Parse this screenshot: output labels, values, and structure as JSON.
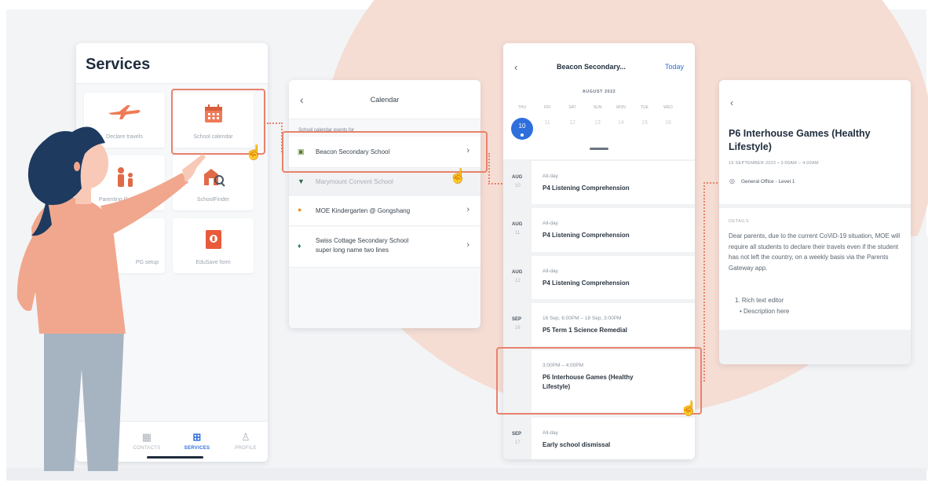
{
  "colors": {
    "accent_highlight": "#e8826c",
    "primary_blue": "#2f6fdc",
    "blob": "#f5ddd4",
    "background": "#f3f4f6"
  },
  "services": {
    "title": "Services",
    "tiles": [
      {
        "label": "Declare travels",
        "icon": "airplane-icon"
      },
      {
        "label": "School calendar",
        "icon": "calendar-icon"
      },
      {
        "label": "Parenting Resources",
        "icon": "parent-child-icon"
      },
      {
        "label": "SchoolFinder",
        "icon": "school-search-icon"
      },
      {
        "label": "PG setup",
        "icon": "setup-icon"
      },
      {
        "label": "EduSave form",
        "icon": "edusave-icon"
      }
    ],
    "tabs": [
      {
        "label": "CONTACTS",
        "icon": "contacts-icon"
      },
      {
        "label": "SERVICES",
        "icon": "services-icon"
      },
      {
        "label": "PROFILE",
        "icon": "profile-icon"
      }
    ]
  },
  "calendar_list": {
    "title": "Calendar",
    "subtitle": "School calendar events for",
    "schools": [
      {
        "name": "Beacon Secondary School",
        "line2": "",
        "icon": "school-crest-icon"
      },
      {
        "name": "Marymount Convent School",
        "line2": "",
        "icon": "school-crest-icon"
      },
      {
        "name": "MOE Kindergarten @ Gongshang",
        "line2": "",
        "icon": "school-crest-icon"
      },
      {
        "name": "Swiss Cottage Secondary School",
        "line2": "super long name two lines",
        "icon": "school-crest-icon"
      }
    ]
  },
  "calendar_events": {
    "header": "Beacon Secondary...",
    "today_label": "Today",
    "month": "AUGUST 2022",
    "weekdays": [
      "THU",
      "FRI",
      "SAT",
      "SUN",
      "MON",
      "TUE",
      "WED"
    ],
    "days": [
      "10",
      "11",
      "12",
      "13",
      "14",
      "15",
      "16"
    ],
    "selected_day": "10",
    "events": [
      {
        "month": "AUG",
        "day": "10",
        "time": "All-day",
        "name": "P4 Listening Comprehension"
      },
      {
        "month": "AUG",
        "day": "11",
        "time": "All-day",
        "name": "P4 Listening Comprehension"
      },
      {
        "month": "AUG",
        "day": "12",
        "time": "All-day",
        "name": "P4 Listening Comprehension"
      },
      {
        "month": "SEP",
        "day": "16",
        "time": "16 Sep, 6:00PM – 18 Sep, 3:00PM",
        "name": "P5 Term 1 Science Remedial"
      },
      {
        "month": "",
        "day": "",
        "time": "3:00PM – 4:00PM",
        "name": "P6 Interhouse Games (Healthy Lifestyle)"
      },
      {
        "month": "SEP",
        "day": "17",
        "time": "All-day",
        "name": "Early school dismissal"
      }
    ]
  },
  "event_detail": {
    "title": "P6 Interhouse Games (Healthy Lifestyle)",
    "datetime": "16 SEPTEMBER 2022 • 3:00AM – 4:00AM",
    "location": "General Office - Level 1",
    "details_label": "DETAILS",
    "description": "Dear parents, due to the current CoViD-19 situation, MOE will require all students to declare their travels even if the student has not left the country, on a weekly basis via the Parents Gateway app.",
    "list_item_1": "1. Rich text editor",
    "list_item_2": "• Description here"
  }
}
